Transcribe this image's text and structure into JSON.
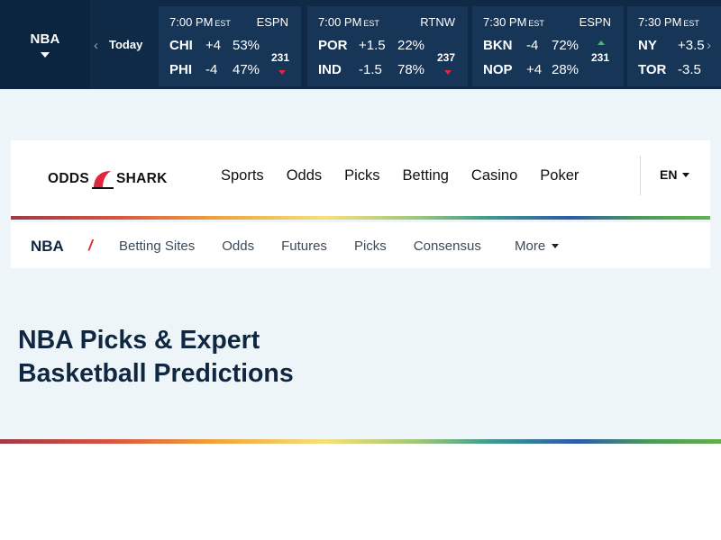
{
  "ticker": {
    "league": "NBA",
    "day": "Today",
    "games": [
      {
        "time": "7:00 PM",
        "tz": "EST",
        "network": "ESPN",
        "away": {
          "team": "CHI",
          "spread": "+4",
          "pct": "53%"
        },
        "home": {
          "team": "PHI",
          "spread": "-4",
          "pct": "47%"
        },
        "total": "231",
        "trend": "down"
      },
      {
        "time": "7:00 PM",
        "tz": "EST",
        "network": "RTNW",
        "away": {
          "team": "POR",
          "spread": "+1.5",
          "pct": "22%"
        },
        "home": {
          "team": "IND",
          "spread": "-1.5",
          "pct": "78%"
        },
        "total": "237",
        "trend": "down"
      },
      {
        "time": "7:30 PM",
        "tz": "EST",
        "network": "ESPN",
        "away": {
          "team": "BKN",
          "spread": "-4",
          "pct": "72%"
        },
        "home": {
          "team": "NOP",
          "spread": "+4",
          "pct": "28%"
        },
        "total": "231",
        "trend": "up"
      },
      {
        "time": "7:30 PM",
        "tz": "EST",
        "network": "",
        "away": {
          "team": "NY",
          "spread": "+3.5",
          "pct": ""
        },
        "home": {
          "team": "TOR",
          "spread": "-3.5",
          "pct": ""
        },
        "total": "",
        "trend": ""
      }
    ]
  },
  "header": {
    "logo_left": "ODDS",
    "logo_right": "SHARK",
    "nav": [
      "Sports",
      "Odds",
      "Picks",
      "Betting",
      "Casino",
      "Poker"
    ],
    "language": "EN"
  },
  "subnav": {
    "section": "NBA",
    "separator": "/",
    "links": [
      "Betting Sites",
      "Odds",
      "Futures",
      "Picks",
      "Consensus"
    ],
    "more": "More"
  },
  "page": {
    "title_line1": "NBA Picks & Expert",
    "title_line2": "Basketball Predictions"
  },
  "colors": {
    "ticker_bg": "#0e2a47",
    "card_bg": "#173556",
    "accent_red": "#e0263c",
    "accent_green": "#3cc25c",
    "band_bg": "#eef5f9",
    "title_text": "#0f2740"
  }
}
